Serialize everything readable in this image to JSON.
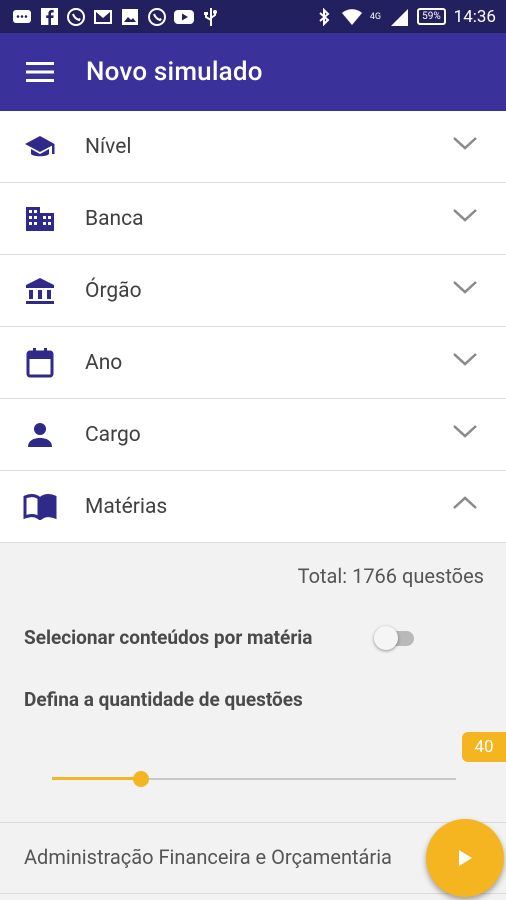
{
  "status_bar": {
    "time": "14:36",
    "battery": "59%",
    "network": "4G",
    "notification_icons": [
      "message-icon",
      "facebook-icon",
      "whatsapp-icon",
      "gmail-icon",
      "gallery-icon",
      "whatsapp-icon",
      "youtube-icon",
      "usb-icon"
    ]
  },
  "app_bar": {
    "title": "Novo simulado"
  },
  "filters": [
    {
      "label": "Nível",
      "icon": "graduation-cap-icon",
      "expanded": false
    },
    {
      "label": "Banca",
      "icon": "building-icon",
      "expanded": false
    },
    {
      "label": "Órgão",
      "icon": "institution-icon",
      "expanded": false
    },
    {
      "label": "Ano",
      "icon": "calendar-icon",
      "expanded": false
    },
    {
      "label": "Cargo",
      "icon": "person-icon",
      "expanded": false
    },
    {
      "label": "Matérias",
      "icon": "book-icon",
      "expanded": true
    }
  ],
  "materias_panel": {
    "total_text": "Total: 1766 questões",
    "select_by_subject_label": "Selecionar conteúdos por matéria",
    "select_by_subject_on": false,
    "quantity_label": "Defina a quantidade de questões",
    "quantity_value": "40",
    "slider_fraction": 0.22,
    "subject_item": "Administração Financeira e Orçamentária"
  },
  "colors": {
    "primary": "#3a329a",
    "status_bar": "#23205f",
    "accent": "#f5b520",
    "icon": "#2f2a8a"
  }
}
